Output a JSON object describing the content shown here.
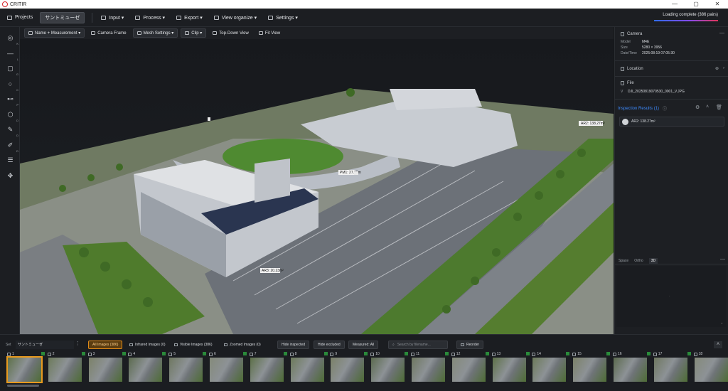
{
  "window": {
    "title": "CRITIR"
  },
  "menubar": {
    "projects": "Projects",
    "project_name": "サントミューゼ",
    "menus": [
      "Input ▾",
      "Process ▾",
      "Export ▾",
      "View organize ▾",
      "Settings ▾"
    ]
  },
  "status": {
    "loading": "Loading complete (386 pairs)"
  },
  "lefttools": [
    {
      "icon": "target-icon",
      "glyph": "◎",
      "sub": "K"
    },
    {
      "icon": "line-measure-icon",
      "glyph": "—",
      "sub": "L"
    },
    {
      "icon": "area-measure-icon",
      "glyph": "▢",
      "sub": "G"
    },
    {
      "icon": "circle-measure-icon",
      "glyph": "○",
      "sub": "C"
    },
    {
      "icon": "height-measure-icon",
      "glyph": "⊷",
      "sub": "P"
    },
    {
      "icon": "polygon-measure-icon",
      "glyph": "⬡",
      "sub": "D"
    },
    {
      "icon": "pen-icon",
      "glyph": "✎",
      "sub": "D"
    },
    {
      "icon": "edit-icon",
      "glyph": "✐",
      "sub": "D"
    },
    {
      "icon": "sliders-icon",
      "glyph": "☰",
      "sub": ""
    },
    {
      "icon": "move-icon",
      "glyph": "✥",
      "sub": ""
    }
  ],
  "viewtoolbar": {
    "name_measurement": "Name + Measurement ▾",
    "camera_frame": "Camera Frame",
    "mesh_settings": "Mesh Settings ▾",
    "clip": "Clip ▾",
    "top_down": "Top-Down View",
    "fit_view": "Fit View"
  },
  "scene_labels": {
    "ar2": "AR2: 138.27m²",
    "pm": "PM1: 27.80m",
    "ar3": "AR3: 20.23m²"
  },
  "rightpanel": {
    "camera": {
      "header": "Camera",
      "model_k": "Model",
      "model_v": "M4E",
      "size_k": "Size",
      "size_v": "5280 × 3956",
      "date_k": "Date/Time",
      "date_v": "2025:08:19 07:05:30"
    },
    "location": {
      "header": "Location"
    },
    "file": {
      "header": "File",
      "name": "DJI_20250819070530_0001_V.JPG",
      "prefix": "V"
    },
    "inspection": {
      "header": "Inspection Results (1)",
      "item": "AR2: 138.27m²"
    },
    "tabs": [
      "Space",
      "Ortho",
      "3D"
    ],
    "accent": "#3d8bff"
  },
  "filmbar": {
    "set_label": "Set",
    "set_value": "サントミューゼ",
    "filters": {
      "all": "All Images (386)",
      "infrared": "Infrared Images (0)",
      "visible": "Visible Images (386)",
      "zoomed": "Zoomed Images (0)"
    },
    "hide_inspected": "Hide inspected",
    "hide_excluded": "Hide excluded",
    "measured": "Measured: All",
    "search_placeholder": "Search by filename...",
    "reorder": "Reorder",
    "thumbs": [
      "1",
      "2",
      "3",
      "4",
      "5",
      "6",
      "7",
      "8",
      "9",
      "10",
      "11",
      "12",
      "13",
      "14",
      "15",
      "16",
      "17",
      "18"
    ],
    "selected_index": 0
  }
}
